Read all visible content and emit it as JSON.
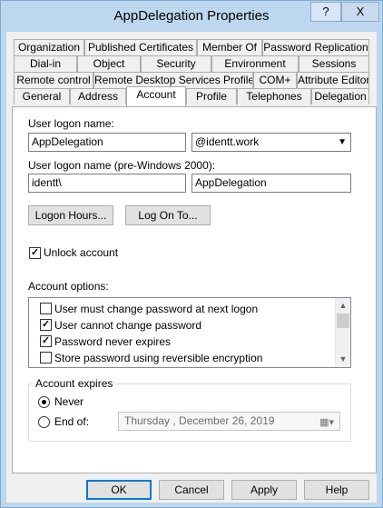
{
  "window": {
    "title": "AppDelegation Properties",
    "help_label": "?",
    "close_label": "X"
  },
  "tabs": {
    "row1": [
      "Organization",
      "Published Certificates",
      "Member Of",
      "Password Replication"
    ],
    "row2": [
      "Dial-in",
      "Object",
      "Security",
      "Environment",
      "Sessions"
    ],
    "row3": [
      "Remote control",
      "Remote Desktop Services Profile",
      "COM+",
      "Attribute Editor"
    ],
    "row4": [
      "General",
      "Address",
      "Account",
      "Profile",
      "Telephones",
      "Delegation"
    ],
    "active": "Account"
  },
  "account": {
    "logon_name_label": "User logon name:",
    "logon_name_value": "AppDelegation",
    "domain_suffix": "@identt.work",
    "pre2000_label": "User logon name (pre-Windows 2000):",
    "pre2000_domain": "identt\\",
    "pre2000_name": "AppDelegation",
    "logon_hours_button": "Logon Hours...",
    "logon_to_button": "Log On To...",
    "unlock_label": "Unlock account",
    "unlock_checked": true,
    "options_label": "Account options:",
    "options": [
      {
        "label": "User must change password at next logon",
        "checked": false
      },
      {
        "label": "User cannot change password",
        "checked": true
      },
      {
        "label": "Password never expires",
        "checked": true
      },
      {
        "label": "Store password using reversible encryption",
        "checked": false
      }
    ],
    "expires_label": "Account expires",
    "never_label": "Never",
    "endof_label": "End of:",
    "expires_selected": "Never",
    "date_weekday": "Thursday",
    "date_rest": ", December 26, 2019"
  },
  "footer": {
    "ok": "OK",
    "cancel": "Cancel",
    "apply": "Apply",
    "help": "Help"
  },
  "icons": {
    "check": "check-mark",
    "radio": "radio-dot",
    "combo": "chevron-down-icon",
    "calendar": "calendar-icon"
  }
}
